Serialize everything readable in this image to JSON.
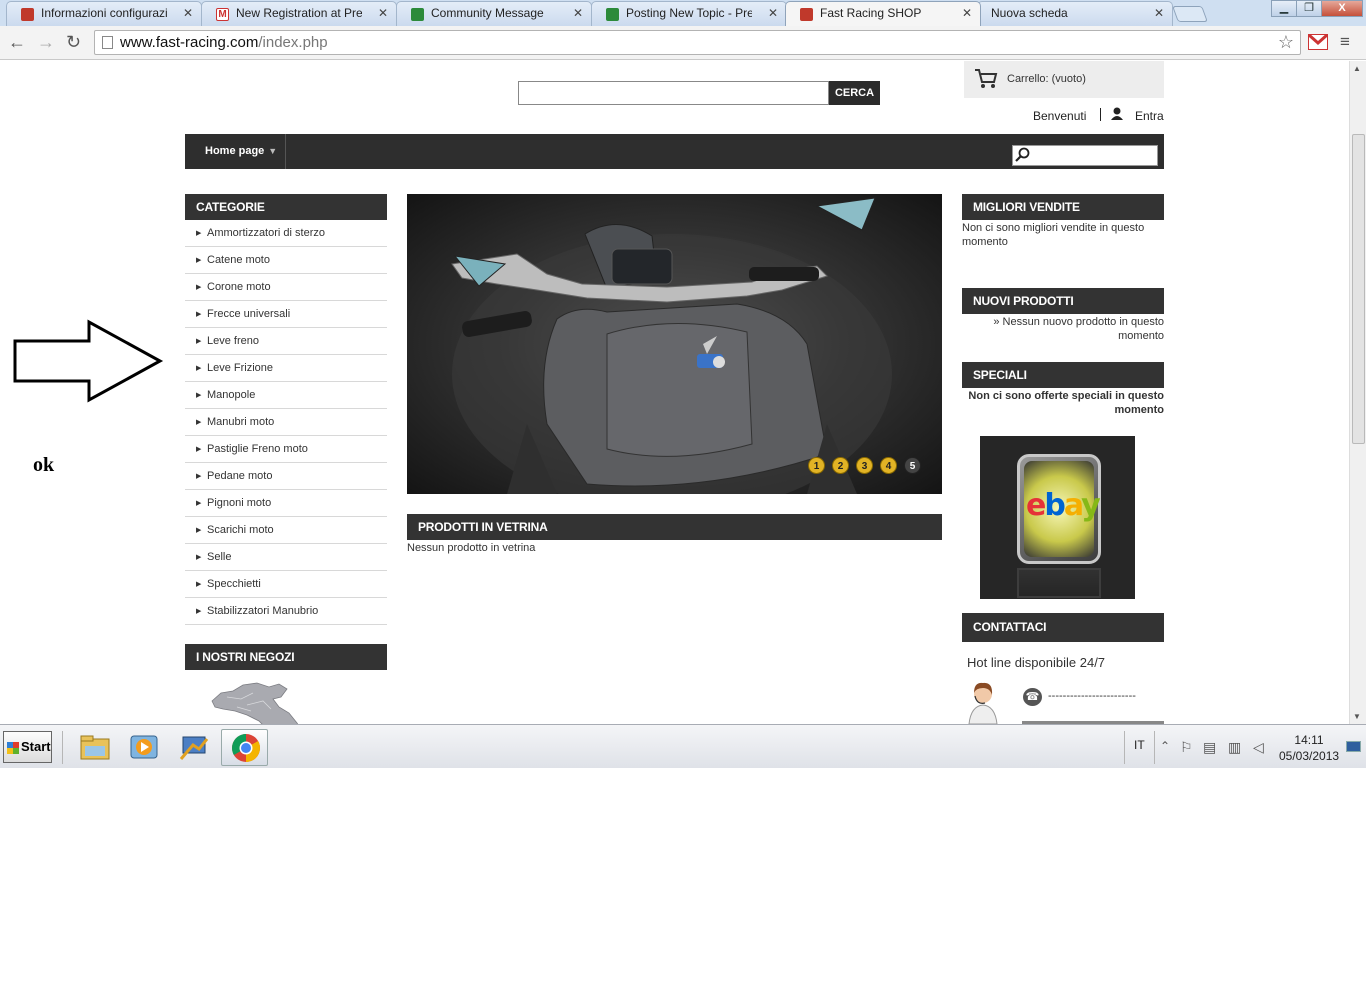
{
  "browser": {
    "tabs": [
      {
        "title": "Informazioni configurazio",
        "fav": "#c0392b"
      },
      {
        "title": "New Registration at Presta",
        "fav": "gmail"
      },
      {
        "title": "Community Message",
        "fav": "#2c8a3a"
      },
      {
        "title": "Posting New Topic - Prest",
        "fav": "#2c8a3a"
      },
      {
        "title": "Fast Racing SHOP",
        "fav": "#c0392b"
      },
      {
        "title": "Nuova scheda",
        "fav": ""
      }
    ],
    "close_glyph": "✕",
    "url_domain": "www.fast-racing.com",
    "url_path": "/index.php",
    "window_controls": {
      "min": "▁",
      "max": "❐",
      "close": "X"
    }
  },
  "header": {
    "search_button": "CERCA",
    "cart_label": "Carrello:",
    "cart_status": "(vuoto)",
    "welcome": "Benvenuti",
    "login": "Entra"
  },
  "menu": {
    "home": "Home page"
  },
  "categories": {
    "title": "CATEGORIE",
    "items": [
      "Ammortizzatori di sterzo",
      "Catene moto",
      "Corone moto",
      "Frecce universali",
      "Leve freno",
      "Leve Frizione",
      "Manopole",
      "Manubri moto",
      "Pastiglie Freno moto",
      "Pedane moto",
      "Pignoni moto",
      "Scarichi moto",
      "Selle",
      "Specchietti",
      "Stabilizzatori Manubrio"
    ]
  },
  "stores": {
    "title": "I NOSTRI NEGOZI"
  },
  "slider": {
    "pages": [
      "1",
      "2",
      "3",
      "4",
      "5"
    ],
    "current": "5"
  },
  "featured": {
    "title": "PRODOTTI IN VETRINA",
    "empty": "Nessun prodotto in vetrina"
  },
  "right": {
    "bestsellers": {
      "title": "MIGLIORI VENDITE",
      "text": "Non ci sono migliori vendite in questo momento"
    },
    "new_products": {
      "title": "NUOVI PRODOTTI",
      "text": "» Nessun nuovo prodotto in questo momento"
    },
    "specials": {
      "title": "SPECIALI",
      "text": "Non ci sono offerte speciali in questo momento"
    },
    "ebay_logo": "ebay",
    "contact": {
      "title": "CONTATTACI",
      "hotline": "Hot line disponibile 24/7",
      "phone": "------------------------"
    }
  },
  "annotation": {
    "ok": "ok"
  },
  "taskbar": {
    "start": "Start",
    "lang": "IT",
    "time": "14:11",
    "date": "05/03/2013"
  }
}
